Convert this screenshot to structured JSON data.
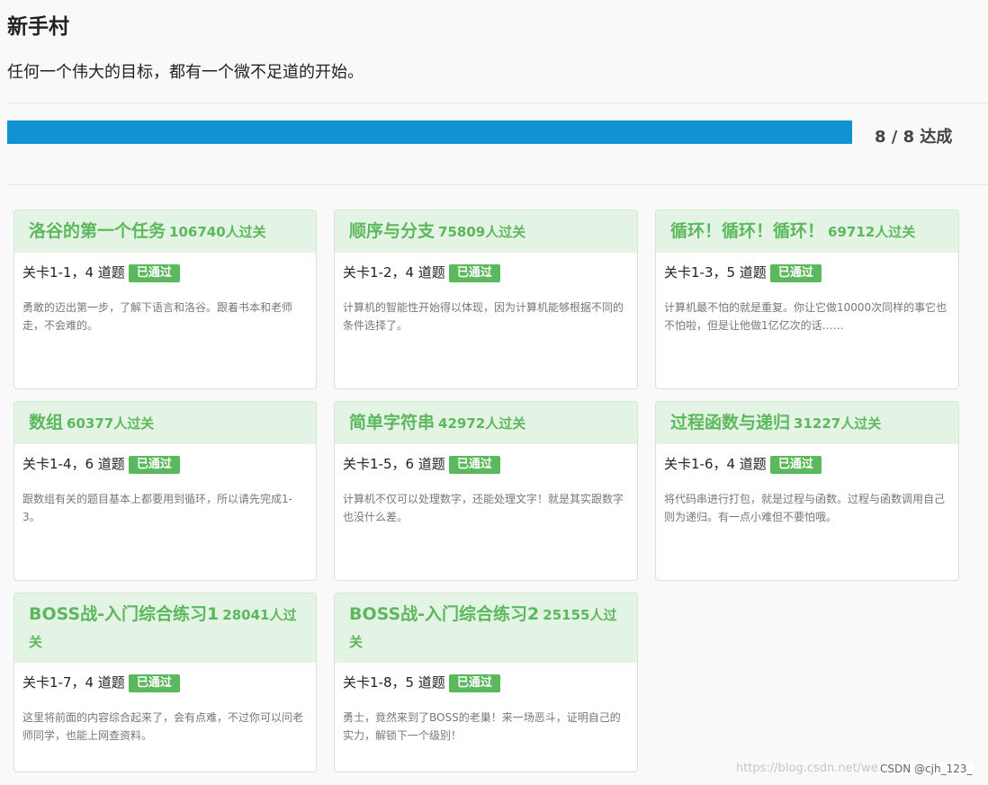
{
  "page": {
    "title": "新手村",
    "subtitle": "任何一个伟大的目标，都有一个微不足道的开始。"
  },
  "progress": {
    "completed": 8,
    "total": 8,
    "fraction": 1.0,
    "label": "8 / 8 达成"
  },
  "colors": {
    "progress_fill": "#1192d2",
    "card_accent": "#5cb85c",
    "card_header_bg": "#e4f4e4"
  },
  "count_suffix": "人过关",
  "badge_label": "已通过",
  "levels": [
    {
      "name": "洛谷的第一个任务",
      "count": "106740",
      "meta": "关卡1-1，4 道题",
      "description": "勇敢的迈出第一步，了解下语言和洛谷。跟着书本和老师走，不会难的。"
    },
    {
      "name": "顺序与分支",
      "count": "75809",
      "meta": "关卡1-2，4 道题",
      "description": "计算机的智能性开始得以体现，因为计算机能够根据不同的条件选择了。"
    },
    {
      "name": "循环！循环！循环！",
      "count": "69712",
      "meta": "关卡1-3，5 道题",
      "description": "计算机最不怕的就是重复。你让它做10000次同样的事它也不怕啦，但是让他做1亿亿次的话……"
    },
    {
      "name": "数组",
      "count": "60377",
      "meta": "关卡1-4，6 道题",
      "description": "跟数组有关的题目基本上都要用到循环，所以请先完成1-3。"
    },
    {
      "name": "简单字符串",
      "count": "42972",
      "meta": "关卡1-5，6 道题",
      "description": "计算机不仅可以处理数字，还能处理文字！就是其实跟数字也没什么差。"
    },
    {
      "name": "过程函数与递归",
      "count": "31227",
      "meta": "关卡1-6，4 道题",
      "description": "将代码串进行打包，就是过程与函数。过程与函数调用自己则为递归。有一点小难但不要怕哦。"
    },
    {
      "name": "BOSS战-入门综合练习1",
      "count": "28041",
      "meta": "关卡1-7，4 道题",
      "description": "这里将前面的内容综合起来了，会有点难，不过你可以问老师同学，也能上网查资料。"
    },
    {
      "name": "BOSS战-入门综合练习2",
      "count": "25155",
      "meta": "关卡1-8，5 道题",
      "description": "勇士，竟然来到了BOSS的老巢！来一场恶斗，证明自己的实力，解锁下一个级别！"
    }
  ],
  "watermark": {
    "url": "https://blog.csdn.net/weixin_44008",
    "tag": "CSDN @cjh_123_"
  }
}
